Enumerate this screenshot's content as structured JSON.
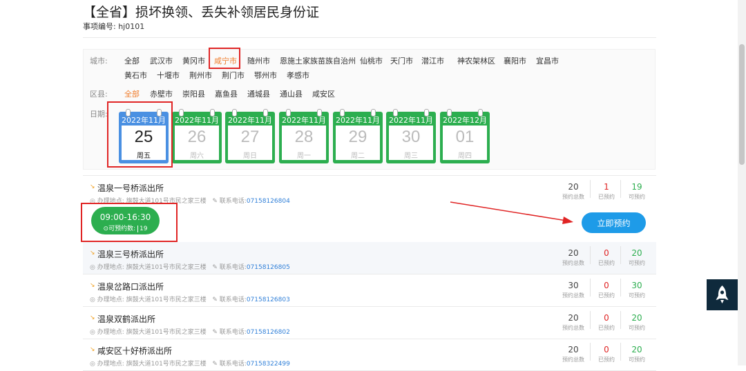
{
  "page": {
    "title": "【全省】损坏换领、丢失补领居民身份证",
    "code_label": "事项编号: hj0101"
  },
  "filter": {
    "city_label": "城市:",
    "cities_row1": [
      "全部",
      "武汉市",
      "黄冈市",
      "咸宁市",
      "随州市",
      "恩施土家族苗族自治州",
      "仙桃市",
      "天门市",
      "潜江市",
      "神农架林区",
      "襄阳市",
      "宜昌市"
    ],
    "cities_row2": [
      "黄石市",
      "十堰市",
      "荆州市",
      "荆门市",
      "鄂州市",
      "孝感市"
    ],
    "selected_city": "咸宁市",
    "district_label": "区县:",
    "districts": [
      "全部",
      "赤壁市",
      "崇阳县",
      "嘉鱼县",
      "通城县",
      "通山县",
      "咸安区"
    ],
    "selected_district": "全部",
    "date_label": "日期:",
    "dates": [
      {
        "month": "2022年11月",
        "day": "25",
        "week": "周五",
        "selected": true
      },
      {
        "month": "2022年11月",
        "day": "26",
        "week": "周六",
        "selected": false
      },
      {
        "month": "2022年11月",
        "day": "27",
        "week": "周日",
        "selected": false
      },
      {
        "month": "2022年11月",
        "day": "28",
        "week": "周一",
        "selected": false
      },
      {
        "month": "2022年11月",
        "day": "29",
        "week": "周二",
        "selected": false
      },
      {
        "month": "2022年11月",
        "day": "30",
        "week": "周三",
        "selected": false
      },
      {
        "month": "2022年12月",
        "day": "01",
        "week": "周四",
        "selected": false
      }
    ]
  },
  "stations": [
    {
      "name": "温泉一号桥派出所",
      "address": "办理地点: 旗鼓大道101号市民之家三楼",
      "phone_label": "联系电话:",
      "phone": "07158126804",
      "total": "20",
      "booked": "1",
      "available": "19"
    },
    {
      "name": "温泉三号桥派出所",
      "address": "办理地点: 旗鼓大道101号市民之家三楼",
      "phone_label": "联系电话:",
      "phone": "07158126805",
      "total": "20",
      "booked": "0",
      "available": "20"
    },
    {
      "name": "温泉岔路口派出所",
      "address": "办理地点: 旗鼓大道101号市民之家三楼",
      "phone_label": "联系电话:",
      "phone": "07158126803",
      "total": "30",
      "booked": "0",
      "available": "30"
    },
    {
      "name": "温泉双鹤派出所",
      "address": "办理地点: 旗鼓大道101号市民之家三楼",
      "phone_label": "联系电话:",
      "phone": "07158126802",
      "total": "20",
      "booked": "0",
      "available": "20"
    },
    {
      "name": "咸安区十好桥派出所",
      "address": "办理地点: 旗鼓大道101号市民之家三楼",
      "phone_label": "联系电话:",
      "phone": "07158322499",
      "total": "20",
      "booked": "0",
      "available": "20"
    }
  ],
  "stat_labels": {
    "total": "预约总数",
    "booked": "已预约",
    "available": "可预约"
  },
  "slot": {
    "time": "09:00-16:30",
    "remaining_label": "⊙可预约数: ",
    "remaining": "19"
  },
  "book_button": "立即预约",
  "colors": {
    "accent_green": "#2cae4f",
    "accent_blue": "#1e9be8",
    "selected_orange": "#f07c2a",
    "highlight_red": "#e02424",
    "booked_red": "#e02424"
  }
}
